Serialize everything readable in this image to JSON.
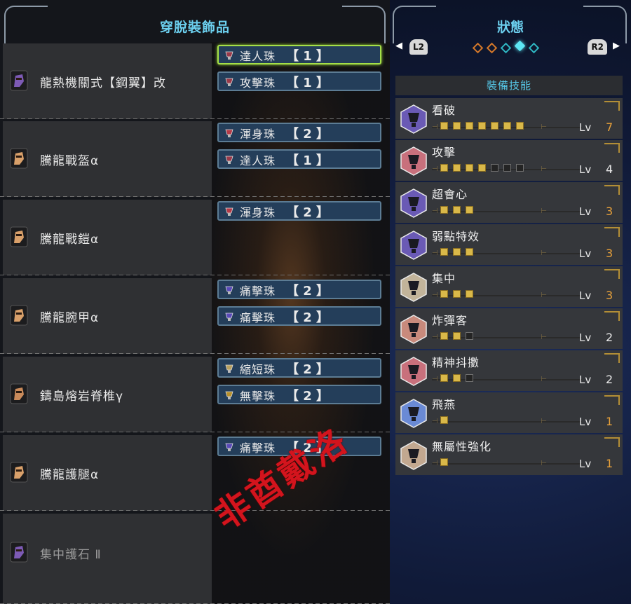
{
  "left_panel": {
    "title": "穿脫裝飾品",
    "equipment": [
      {
        "name": "龍熱機關式【鋼翼】改",
        "icon": "weapon-icon",
        "color": "#7d5ab5",
        "decorations": [
          {
            "name": "達人珠",
            "level": "【 1 】",
            "gem_color": "#9a3a4a",
            "selected": true
          },
          {
            "name": "攻擊珠",
            "level": "【 1 】",
            "gem_color": "#9a3a4a",
            "selected": false
          }
        ]
      },
      {
        "name": "騰龍戰盔α",
        "icon": "helmet-icon",
        "color": "#d9a06a",
        "decorations": [
          {
            "name": "渾身珠",
            "level": "【 2 】",
            "gem_color": "#b43a48",
            "selected": false
          },
          {
            "name": "達人珠",
            "level": "【 1 】",
            "gem_color": "#9a3a4a",
            "selected": false
          }
        ]
      },
      {
        "name": "騰龍戰鎧α",
        "icon": "chest-armor-icon",
        "color": "#d9a06a",
        "decorations": [
          {
            "name": "渾身珠",
            "level": "【 2 】",
            "gem_color": "#b43a48",
            "selected": false
          }
        ]
      },
      {
        "name": "騰龍腕甲α",
        "icon": "arm-armor-icon",
        "color": "#d9a06a",
        "decorations": [
          {
            "name": "痛擊珠",
            "level": "【 2 】",
            "gem_color": "#5a4ab8",
            "selected": false
          },
          {
            "name": "痛擊珠",
            "level": "【 2 】",
            "gem_color": "#5a4ab8",
            "selected": false
          }
        ]
      },
      {
        "name": "鑄島熔岩脊椎γ",
        "icon": "waist-armor-icon",
        "color": "#c98a5a",
        "decorations": [
          {
            "name": "縮短珠",
            "level": "【 2 】",
            "gem_color": "#b8a060",
            "selected": false
          },
          {
            "name": "無擊珠",
            "level": "【 2 】",
            "gem_color": "#b8902a",
            "selected": false
          }
        ]
      },
      {
        "name": "騰龍護腿α",
        "icon": "leg-armor-icon",
        "color": "#d9a06a",
        "decorations": [
          {
            "name": "痛擊珠",
            "level": "【 2 】",
            "gem_color": "#5a4ab8",
            "selected": false
          }
        ]
      },
      {
        "name": "集中護石 Ⅱ",
        "icon": "charm-icon",
        "color": "#7d5ab5",
        "dim": true,
        "decorations": []
      }
    ]
  },
  "watermark": "非酋戴洛",
  "right_panel": {
    "title": "狀態",
    "nav": {
      "left_button": "L2",
      "right_button": "R2",
      "left_arrow": "◀",
      "right_arrow": "▶",
      "pages": [
        "orange",
        "orange",
        "teal",
        "active",
        "teal"
      ]
    },
    "skills_header": "裝備技能",
    "skills": [
      {
        "name": "看破",
        "lv_label": "Lv",
        "level": "7",
        "filled": 7,
        "max": 7,
        "max_color": true,
        "icon_color": "#6a5ab5",
        "icon": "jewel-icon"
      },
      {
        "name": "攻擊",
        "lv_label": "Lv",
        "level": "4",
        "filled": 4,
        "max": 7,
        "max_color": false,
        "icon_color": "#c8707c",
        "icon": "jewel-icon"
      },
      {
        "name": "超會心",
        "lv_label": "Lv",
        "level": "3",
        "filled": 3,
        "max": 3,
        "max_color": true,
        "icon_color": "#6a5ab5",
        "icon": "jewel-icon"
      },
      {
        "name": "弱點特效",
        "lv_label": "Lv",
        "level": "3",
        "filled": 3,
        "max": 3,
        "max_color": true,
        "icon_color": "#6a5ab5",
        "icon": "jewel-icon"
      },
      {
        "name": "集中",
        "lv_label": "Lv",
        "level": "3",
        "filled": 3,
        "max": 3,
        "max_color": true,
        "icon_color": "#c2b49a",
        "icon": "jewel-icon"
      },
      {
        "name": "炸彈客",
        "lv_label": "Lv",
        "level": "2",
        "filled": 2,
        "max": 3,
        "max_color": false,
        "icon_color": "#c88a7c",
        "icon": "jewel-icon"
      },
      {
        "name": "精神抖擻",
        "lv_label": "Lv",
        "level": "2",
        "filled": 2,
        "max": 3,
        "max_color": false,
        "icon_color": "#c8707c",
        "icon": "jewel-icon"
      },
      {
        "name": "飛燕",
        "lv_label": "Lv",
        "level": "1",
        "filled": 1,
        "max": 1,
        "max_color": true,
        "icon_color": "#6a8ad5",
        "icon": "jewel-icon"
      },
      {
        "name": "無屬性強化",
        "lv_label": "Lv",
        "level": "1",
        "filled": 1,
        "max": 1,
        "max_color": true,
        "icon_color": "#c2a890",
        "icon": "jewel-icon"
      }
    ]
  }
}
